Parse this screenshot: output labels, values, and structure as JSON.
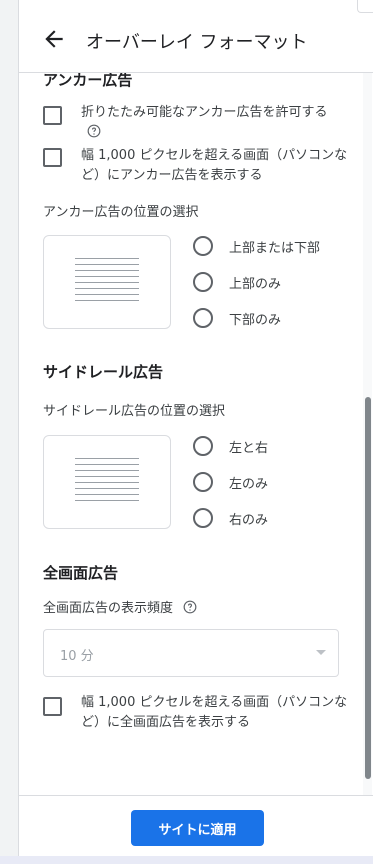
{
  "header": {
    "title": "オーバーレイ フォーマット",
    "back_icon": "arrow-left-icon"
  },
  "anchor": {
    "title": "アンカー広告",
    "checkbox_collapsible": "折りたたみ可能なアンカー広告を許可する",
    "checkbox_large_screen": "幅 1,000 ピクセルを超える画面（パソコンなど）にアンカー広告を表示する",
    "position_label": "アンカー広告の位置の選択",
    "options": [
      "上部または下部",
      "上部のみ",
      "下部のみ"
    ]
  },
  "siderail": {
    "title": "サイドレール広告",
    "position_label": "サイドレール広告の位置の選択",
    "options": [
      "左と右",
      "左のみ",
      "右のみ"
    ]
  },
  "interstitial": {
    "title": "全画面広告",
    "frequency_label": "全画面広告の表示頻度",
    "frequency_value": "10 分",
    "checkbox_large_screen": "幅 1,000 ピクセルを超える画面（パソコンなど）に全画面広告を表示する"
  },
  "footer": {
    "apply_label": "サイトに適用"
  },
  "colors": {
    "accent": "#1a73e8",
    "text": "#3c4043",
    "border": "#dadce0"
  }
}
